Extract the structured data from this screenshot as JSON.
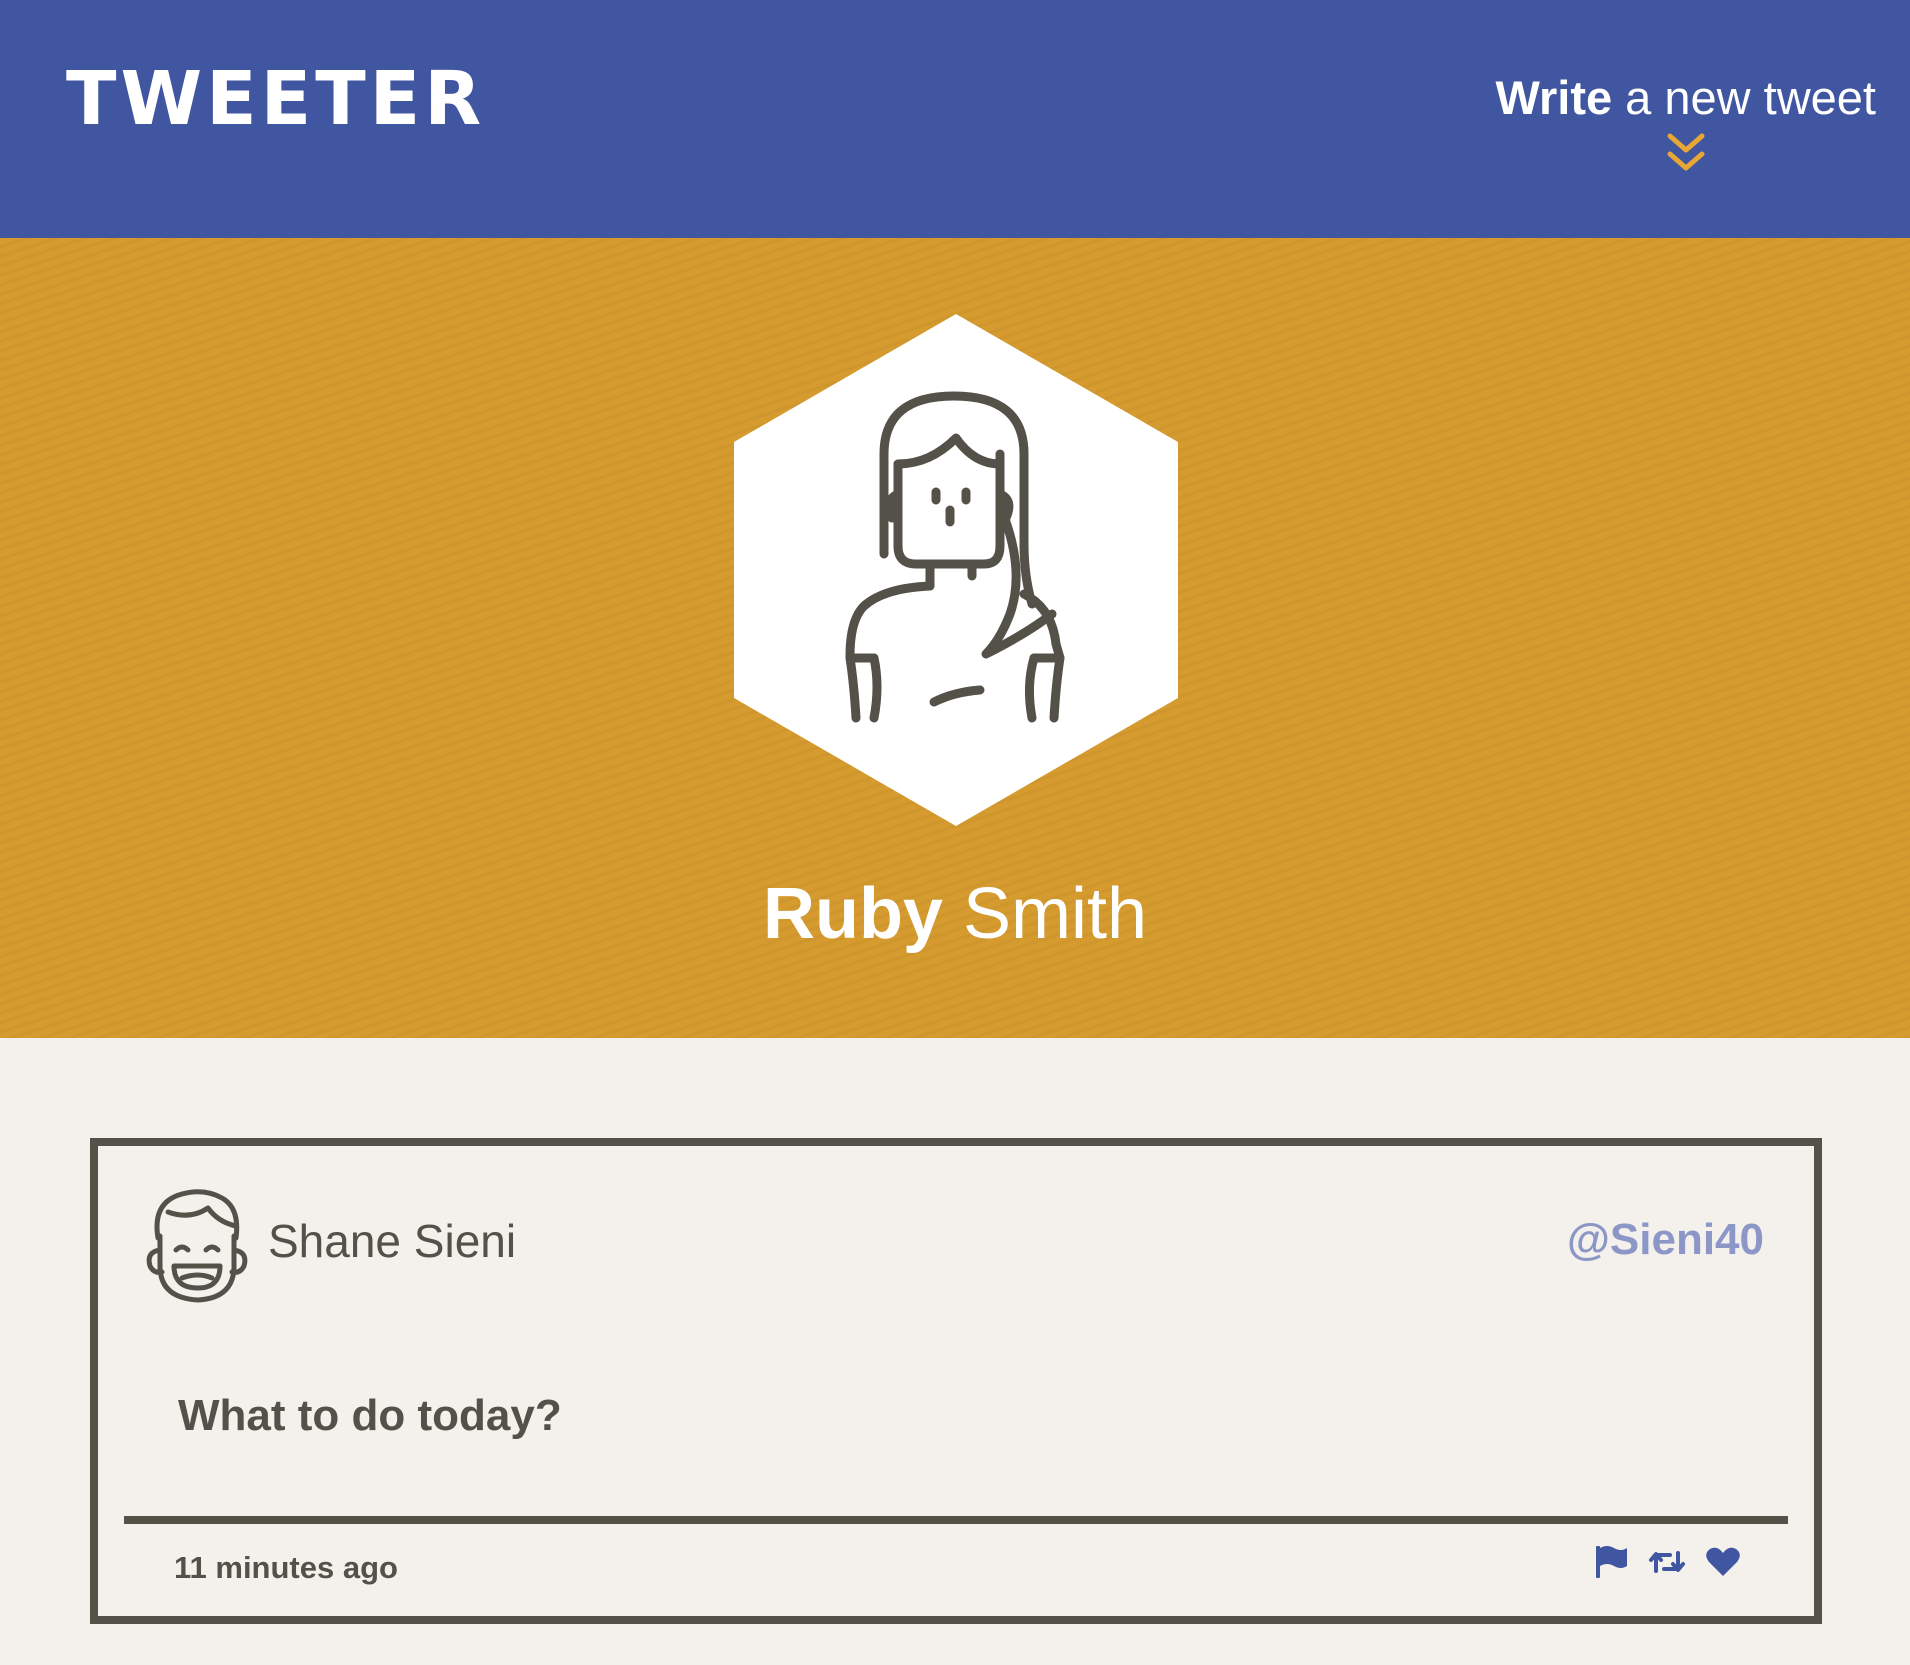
{
  "app": {
    "brand": "TWEETER"
  },
  "nav": {
    "compose_strong": "Write",
    "compose_rest": " a new tweet",
    "compose_icon": "double-chevron-down-icon",
    "accent_color": "#e8a735"
  },
  "profile": {
    "first_name": "Ruby",
    "last_name": "Smith",
    "avatar_icon": "woman-avatar-icon",
    "background_color": "#d69b2f"
  },
  "tweets": [
    {
      "author_name": "Shane Sieni",
      "handle": "@Sieni40",
      "avatar_icon": "laughing-man-avatar-icon",
      "content": "What to do today?",
      "time_ago": "11 minutes ago",
      "actions": [
        "flag-icon",
        "retweet-icon",
        "heart-icon"
      ]
    }
  ],
  "colors": {
    "navbar": "#4056a1",
    "text": "#545149",
    "handle": "#8c97c8",
    "page_background": "#f4f1ec"
  }
}
